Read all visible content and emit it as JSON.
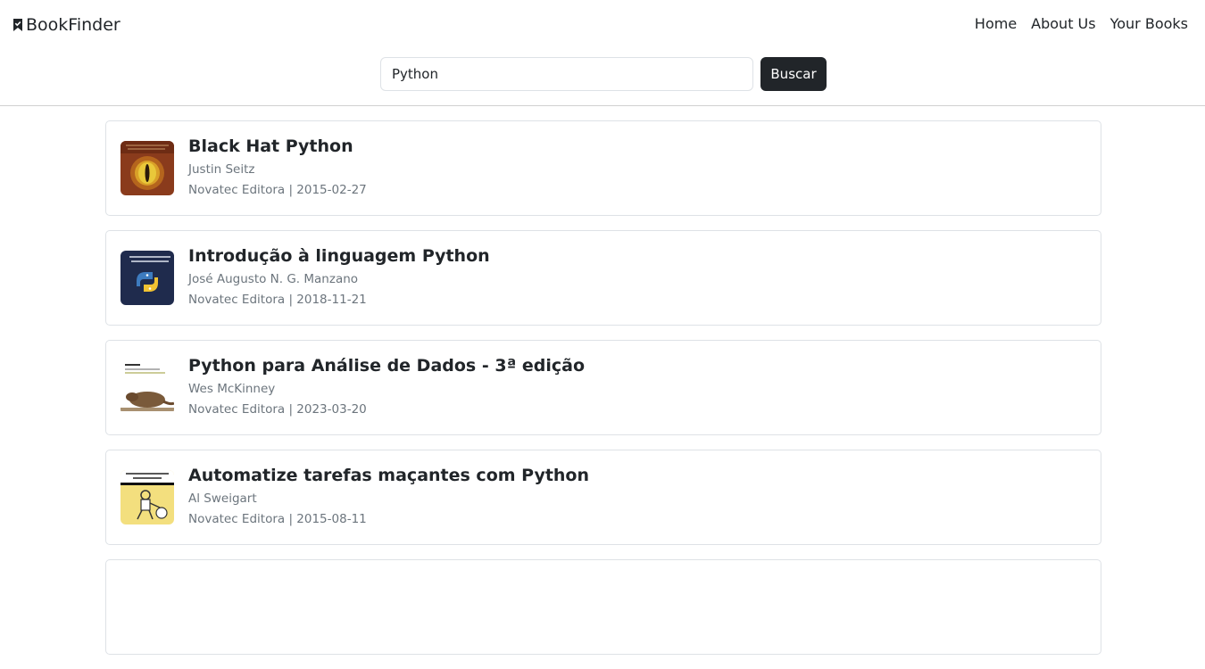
{
  "header": {
    "brand": "BookFinder",
    "nav": [
      "Home",
      "About Us",
      "Your Books"
    ]
  },
  "search": {
    "value": "Python",
    "button_label": "Buscar"
  },
  "results": [
    {
      "title": "Black Hat Python",
      "author": "Justin Seitz",
      "meta": "Novatec Editora | 2015-02-27",
      "cover_icon": "dragon-eye-cover-icon"
    },
    {
      "title": "Introdução à linguagem Python",
      "author": "José Augusto N. G. Manzano",
      "meta": "Novatec Editora | 2018-11-21",
      "cover_icon": "python-logo-cover-icon"
    },
    {
      "title": "Python para Análise de Dados - 3ª edição",
      "author": "Wes McKinney",
      "meta": "Novatec Editora | 2023-03-20",
      "cover_icon": "animal-cover-icon"
    },
    {
      "title": "Automatize tarefas maçantes com Python",
      "author": "Al Sweigart",
      "meta": "Novatec Editora | 2015-08-11",
      "cover_icon": "robot-cover-icon"
    }
  ],
  "colors": {
    "dark_button": "#212529",
    "muted_text": "#6c757d",
    "border": "#dee2e6"
  }
}
